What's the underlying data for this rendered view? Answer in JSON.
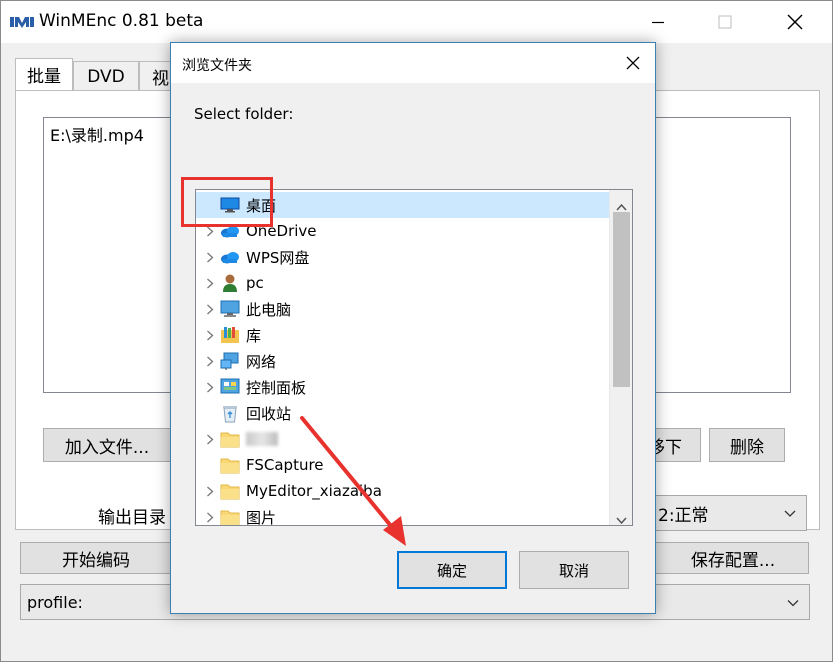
{
  "window": {
    "title": "WinMEnc 0.81 beta"
  },
  "tabs": [
    "批量",
    "DVD",
    "视"
  ],
  "file_list": [
    "E:\\录制.mp4"
  ],
  "buttons": {
    "add_files": "加入文件...",
    "move_down": "移下",
    "delete": "删除",
    "start_encode": "开始编码",
    "save_config": "保存配置..."
  },
  "output_dir_label": "输出目录",
  "priority_combo_value": "2:正常",
  "profile_combo_value": "profile:",
  "dialog": {
    "title": "浏览文件夹",
    "prompt": "Select folder:",
    "ok": "确定",
    "cancel": "取消",
    "tree": [
      {
        "label": "桌面",
        "icon": "desktop-icon",
        "expander": false,
        "selected": true
      },
      {
        "label": "OneDrive",
        "icon": "cloud-icon",
        "expander": true
      },
      {
        "label": "WPS网盘",
        "icon": "cloud-icon",
        "expander": true
      },
      {
        "label": "pc",
        "icon": "user-icon",
        "expander": true
      },
      {
        "label": "此电脑",
        "icon": "computer-icon",
        "expander": true
      },
      {
        "label": "库",
        "icon": "library-icon",
        "expander": true
      },
      {
        "label": "网络",
        "icon": "network-icon",
        "expander": true
      },
      {
        "label": "控制面板",
        "icon": "control-panel-icon",
        "expander": true
      },
      {
        "label": "回收站",
        "icon": "recycle-bin-icon",
        "expander": false
      },
      {
        "label": "",
        "icon": "folder-icon",
        "expander": true,
        "blurred": true
      },
      {
        "label": "FSCapture",
        "icon": "folder-icon",
        "expander": false
      },
      {
        "label": "MyEditor_xiazaiba",
        "icon": "folder-icon",
        "expander": true
      },
      {
        "label": "图片",
        "icon": "folder-icon",
        "expander": true
      }
    ]
  },
  "colors": {
    "highlight": "#e8322e",
    "selection": "#cce8ff",
    "accent": "#0078d7"
  }
}
